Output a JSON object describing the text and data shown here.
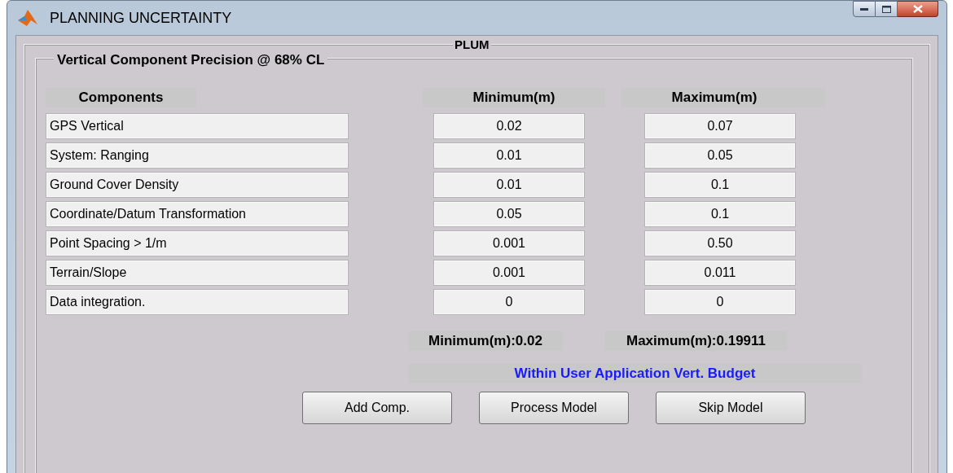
{
  "window": {
    "title": "PLANNING UNCERTAINTY"
  },
  "panel": {
    "title": "PLUM"
  },
  "subpanel": {
    "title": "Vertical Component Precision @ 68% CL"
  },
  "columns": [
    "Components",
    "Minimum(m)",
    "Maximum(m)"
  ],
  "rows": [
    {
      "component": "GPS Vertical",
      "minimum": "0.02",
      "maximum": "0.07"
    },
    {
      "component": "System: Ranging",
      "minimum": "0.01",
      "maximum": "0.05"
    },
    {
      "component": "Ground Cover Density",
      "minimum": "0.01",
      "maximum": "0.1"
    },
    {
      "component": "Coordinate/Datum Transformation",
      "minimum": "0.05",
      "maximum": "0.1"
    },
    {
      "component": "Point Spacing > 1/m",
      "minimum": "0.001",
      "maximum": "0.50"
    },
    {
      "component": "Terrain/Slope",
      "minimum": "0.001",
      "maximum": "0.011"
    },
    {
      "component": "Data integration.",
      "minimum": "0",
      "maximum": "0"
    }
  ],
  "summary": {
    "minimum": "Minimum(m):0.02",
    "maximum": "Maximum(m):0.19911"
  },
  "status": "Within User Application Vert. Budget",
  "buttons": [
    "Add Comp.",
    "Process Model",
    "Skip Model"
  ]
}
